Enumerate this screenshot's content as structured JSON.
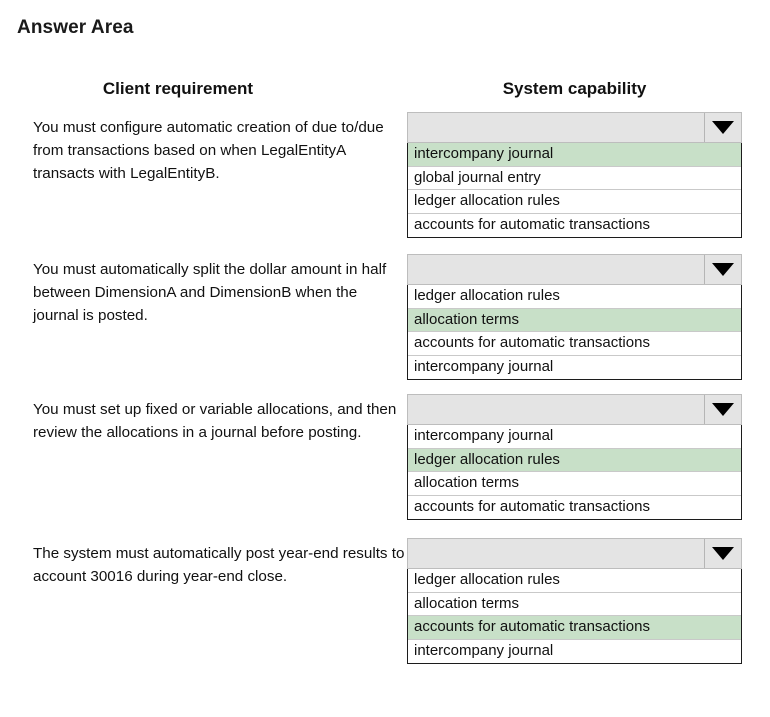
{
  "page": {
    "title": "Answer Area"
  },
  "headers": {
    "left": "Client requirement",
    "right": "System capability"
  },
  "colors": {
    "selected_option_background": "#c8e0c8",
    "combo_background": "#e4e4e4",
    "list_border": "#1c1c1c",
    "page_background": "#ffffff",
    "text": "#111111"
  },
  "icons": {
    "dropdown_arrow": "chevron-down-icon"
  },
  "rows": [
    {
      "requirement": "You must configure automatic creation of due to/due from transactions based on when LegalEntityA transacts with LegalEntityB.",
      "dropdown": {
        "value": "",
        "placeholder": "",
        "options": [
          {
            "label": "intercompany journal",
            "selected": true
          },
          {
            "label": "global journal entry",
            "selected": false
          },
          {
            "label": "ledger allocation rules",
            "selected": false
          },
          {
            "label": "accounts for automatic transactions",
            "selected": false
          }
        ]
      }
    },
    {
      "requirement": "You must automatically split the dollar amount in half between DimensionA and DimensionB when the journal is posted.",
      "dropdown": {
        "value": "",
        "placeholder": "",
        "options": [
          {
            "label": "ledger allocation rules",
            "selected": false
          },
          {
            "label": "allocation terms",
            "selected": true
          },
          {
            "label": "accounts for automatic transactions",
            "selected": false
          },
          {
            "label": "intercompany journal",
            "selected": false
          }
        ]
      }
    },
    {
      "requirement": "You must set up fixed or variable allocations, and then review the allocations in a journal before posting.",
      "dropdown": {
        "value": "",
        "placeholder": "",
        "options": [
          {
            "label": "intercompany journal",
            "selected": false
          },
          {
            "label": "ledger allocation rules",
            "selected": true
          },
          {
            "label": "allocation terms",
            "selected": false
          },
          {
            "label": "accounts for automatic transactions",
            "selected": false
          }
        ]
      }
    },
    {
      "requirement": "The system must automatically post year-end results to account 30016 during year-end close.",
      "dropdown": {
        "value": "",
        "placeholder": "",
        "options": [
          {
            "label": "ledger allocation rules",
            "selected": false
          },
          {
            "label": "allocation terms",
            "selected": false
          },
          {
            "label": "accounts for automatic transactions",
            "selected": true
          },
          {
            "label": "intercompany journal",
            "selected": false
          }
        ]
      }
    }
  ]
}
